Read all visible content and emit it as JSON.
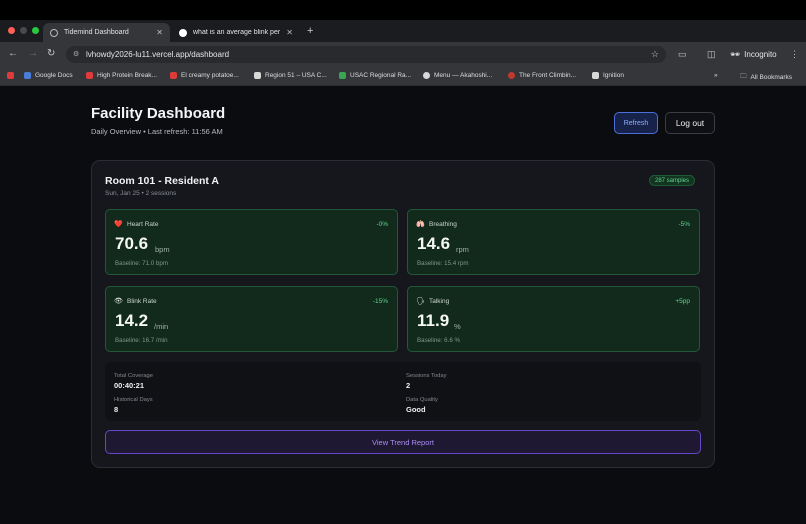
{
  "browser": {
    "tabs": [
      {
        "title": "Tidemind Dashboard",
        "active": true
      },
      {
        "title": "what is an average blink per",
        "active": false
      }
    ],
    "url": "lvhowdy2026-lu11.vercel.app/dashboard",
    "profile_label": "Incognito",
    "bookmarks": [
      {
        "label": "Google Docs",
        "color": "#4a7dd8"
      },
      {
        "label": "High Protein Break...",
        "color": "#e03a3a"
      },
      {
        "label": "El creamy potatoe...",
        "color": "#e03a3a"
      },
      {
        "label": "Region 51 – USA C...",
        "color": "#d8d8d8"
      },
      {
        "label": "USAC Regional Ra...",
        "color": "#3aa655"
      },
      {
        "label": "Menu — Akahoshi...",
        "color": "#d8d8d8"
      },
      {
        "label": "The Front Climbin...",
        "color": "#c0392b"
      },
      {
        "label": "Ignition",
        "color": "#d8d8d8"
      }
    ],
    "all_bookmarks_label": "All Bookmarks"
  },
  "header": {
    "title": "Facility Dashboard",
    "subtitle": "Daily Overview • Last refresh: 11:56 AM",
    "refresh_label": "Refresh",
    "logout_label": "Log out"
  },
  "room": {
    "title": "Room 101 - Resident A",
    "subtitle": "Sun, Jan 25 • 2 sessions",
    "samples_badge": "287 samples",
    "metrics": [
      {
        "label": "Heart Rate",
        "icon": "heart-icon",
        "glyph": "❤️",
        "delta": "-0%",
        "value": "70.6",
        "unit": "bpm",
        "baseline": "Baseline: 71.0 bpm"
      },
      {
        "label": "Breathing",
        "icon": "lungs-icon",
        "glyph": "🫁",
        "delta": "-5%",
        "value": "14.6",
        "unit": "rpm",
        "baseline": "Baseline: 15.4 rpm"
      },
      {
        "label": "Blink Rate",
        "icon": "eye-icon",
        "glyph": "👁",
        "delta": "-15%",
        "value": "14.2",
        "unit": "/min",
        "baseline": "Baseline: 16.7 /min"
      },
      {
        "label": "Talking",
        "icon": "speaking-head-icon",
        "glyph": "🗣",
        "delta": "+5pp",
        "value": "11.9",
        "unit": "%",
        "baseline": "Baseline: 6.6 %"
      }
    ],
    "stats": {
      "total_coverage_label": "Total Coverage",
      "total_coverage_value": "00:40:21",
      "sessions_today_label": "Sessions Today",
      "sessions_today_value": "2",
      "historical_days_label": "Historical Days",
      "historical_days_value": "8",
      "data_quality_label": "Data Quality",
      "data_quality_value": "Good"
    },
    "trend_button_label": "View Trend Report"
  },
  "colors": {
    "accent_green": "#5fd58b",
    "accent_purple": "#a98cf2",
    "accent_blue": "#8fb0ff"
  }
}
